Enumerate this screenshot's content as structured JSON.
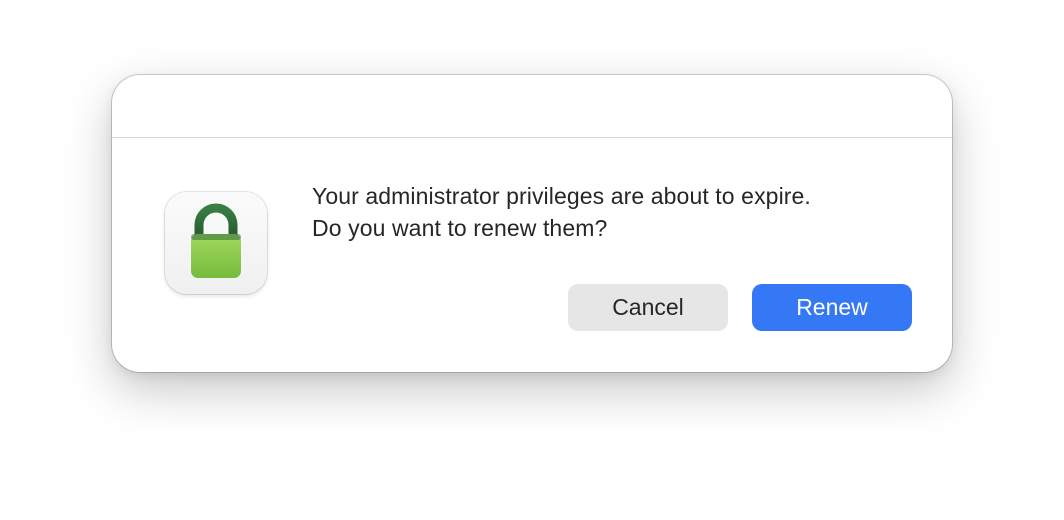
{
  "dialog": {
    "message_line1": "Your administrator privileges are about to expire.",
    "message_line2": "Do you want to renew them?",
    "icon": "lock-icon",
    "buttons": {
      "cancel_label": "Cancel",
      "renew_label": "Renew"
    },
    "colors": {
      "accent": "#3478f6",
      "lock_body": "#8ccc4a",
      "lock_shackle": "#2e6a3a"
    }
  }
}
